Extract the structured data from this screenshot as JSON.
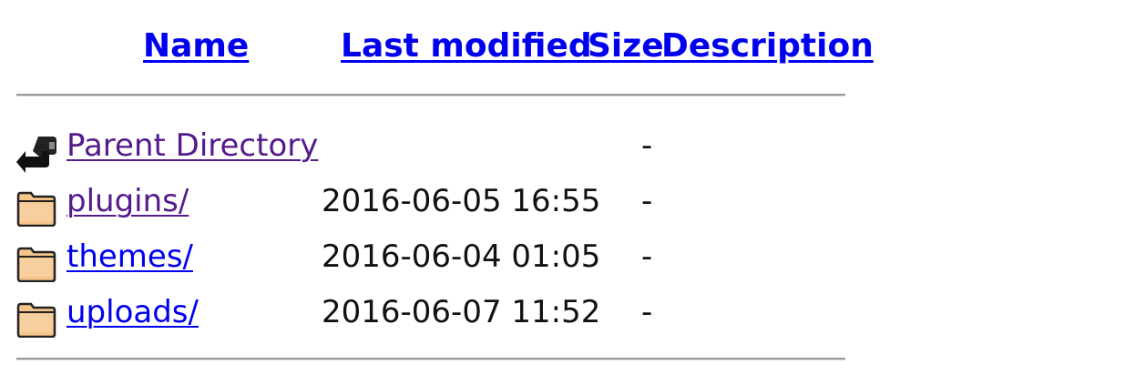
{
  "table_header": {
    "name_label": "Name",
    "modified_label": "Last modified",
    "size_label": "Size",
    "description_label": "Description"
  },
  "entries": [
    {
      "icon": "back-arrow-icon",
      "name": "Parent Directory",
      "modified": "",
      "size": "-",
      "description": "",
      "visited": true
    },
    {
      "icon": "folder-icon",
      "name": "plugins/",
      "modified": "2016-06-05 16:55",
      "size": "-",
      "description": "",
      "visited": true
    },
    {
      "icon": "folder-icon",
      "name": "themes/",
      "modified": "2016-06-04 01:05",
      "size": "-",
      "description": "",
      "visited": false
    },
    {
      "icon": "folder-icon",
      "name": "uploads/",
      "modified": "2016-06-07 11:52",
      "size": "-",
      "description": "",
      "visited": false
    }
  ],
  "colors": {
    "link": "#0000ee",
    "visited_link": "#551a8b",
    "rule": "#9a9a9a",
    "folder_fill": "#f5c48a",
    "folder_outline": "#222222"
  }
}
